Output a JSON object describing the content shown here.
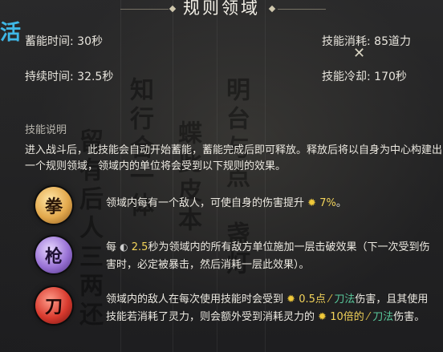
{
  "header": {
    "title": "规则领域",
    "corner_glyph": "活"
  },
  "stats": {
    "charge_time": "蓄能时间: 30秒",
    "duration": "持续时间: 32.5秒",
    "skill_cost": "技能消耗: 85道力",
    "cooldown": "技能冷却: 170秒"
  },
  "description": {
    "label": "技能说明",
    "text": "进入战斗后，此技能会自动开始蓄能，蓄能完成后即可释放。释放后将以自身为中心构建出一个规则领域，领域内的单位将会受到以下规则的效果。"
  },
  "rules": [
    {
      "badge": "拳",
      "badge_color": "#e3a94d",
      "text_a": "领域内每有一个敌人，可使自身的伤害提升",
      "value": "7%",
      "text_b": "。"
    },
    {
      "badge": "枪",
      "badge_color": "#9a73d6",
      "text_a": "每",
      "value": "2.5",
      "text_b": "秒为领域内的所有敌方单位施加一层击破效果（下一次受到伤害时，必定被暴击，然后消耗一层此效果）。"
    },
    {
      "badge": "刀",
      "badge_color": "#d83a2e",
      "text_a": "领域内的敌人在每次使用技能时会受到",
      "value_a": "0.5点",
      "tag": "刀法",
      "text_b": "伤害，且其使用技能若消耗了灵力，则会额外受到消耗灵力的",
      "value_b": "10倍的",
      "text_c": "伤害。"
    }
  ],
  "background_calligraphy": [
    "明台与点一盏灯",
    "知行合一体",
    "留有后人三两还",
    "蝶此皮本"
  ],
  "colors": {
    "accent_blue": "#3fb7e6",
    "highlight_yellow": "#f2d35a",
    "highlight_green": "#58c79a"
  },
  "icons": [
    "close-icon",
    "sun-icon",
    "moon-icon",
    "blade-icon"
  ]
}
